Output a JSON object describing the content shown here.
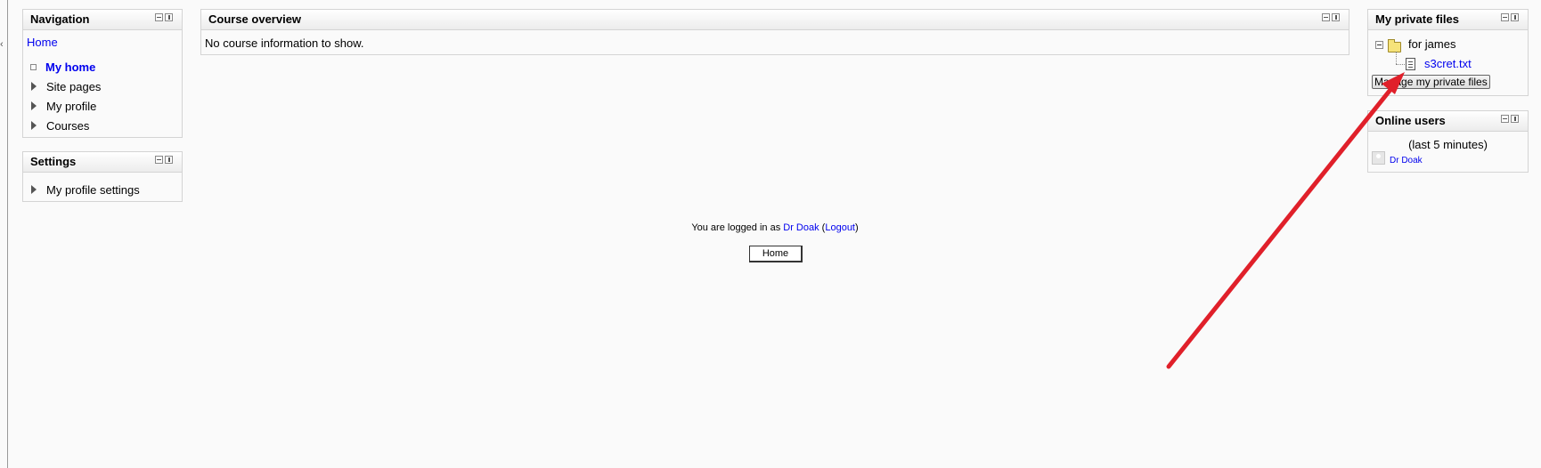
{
  "navigation": {
    "title": "Navigation",
    "home": "Home",
    "items": [
      {
        "label": "My home",
        "bold": true
      },
      {
        "label": "Site pages"
      },
      {
        "label": "My profile"
      },
      {
        "label": "Courses"
      }
    ]
  },
  "settings": {
    "title": "Settings",
    "items": [
      {
        "label": "My profile settings"
      }
    ]
  },
  "course_overview": {
    "title": "Course overview",
    "message": "No course information to show."
  },
  "private_files": {
    "title": "My private files",
    "folder": "for james",
    "file": "s3cret.txt",
    "manage_button": "Manage my private files"
  },
  "online_users": {
    "title": "Online users",
    "period": "(last 5 minutes)",
    "users": [
      "Dr Doak"
    ]
  },
  "footer": {
    "logged_in_prefix": "You are logged in as ",
    "user": "Dr Doak",
    "open_paren": " (",
    "logout": "Logout",
    "close_paren": ")",
    "home_button": "Home"
  },
  "annotation": {
    "arrow_color": "#e0202a"
  }
}
